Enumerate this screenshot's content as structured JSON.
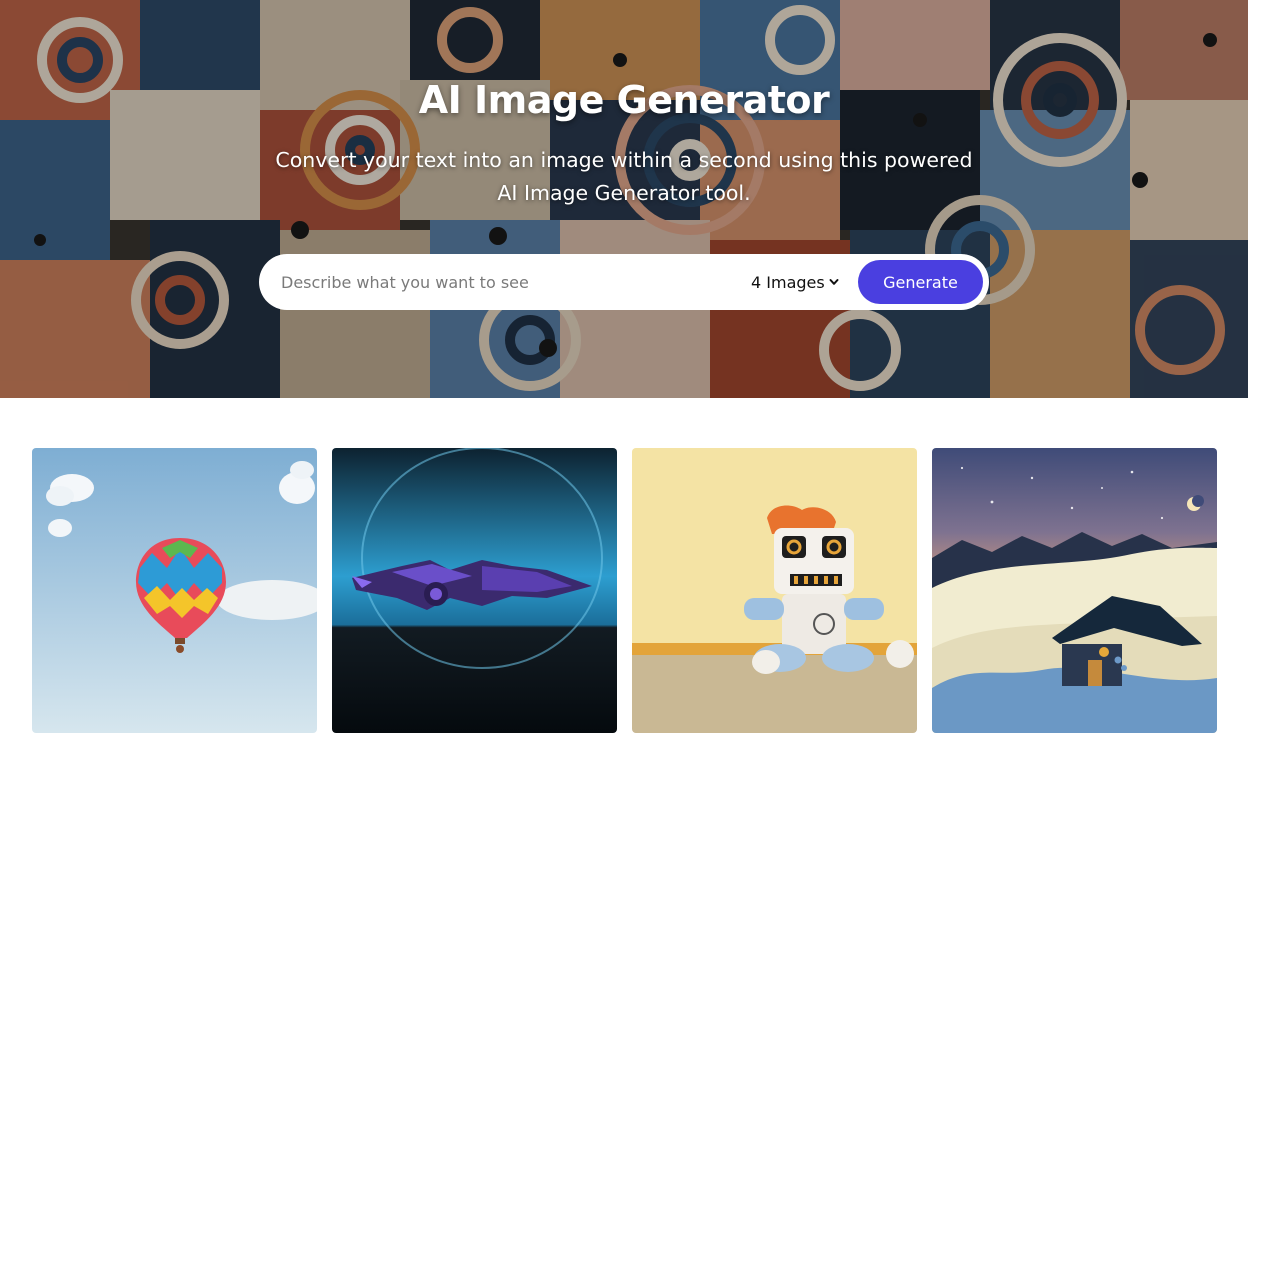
{
  "hero": {
    "title": "AI Image Generator",
    "subtitle_line1": "Convert your text into an image within a second using this powered",
    "subtitle_line2": "AI Image Generator tool."
  },
  "form": {
    "prompt_placeholder": "Describe what you want to see",
    "prompt_value": "",
    "image_count_selected": "4 Images",
    "generate_label": "Generate"
  },
  "colors": {
    "accent": "#4a3fe0",
    "background": "#ffffff"
  },
  "gallery": {
    "images": [
      {
        "subject": "hot-air-balloon"
      },
      {
        "subject": "spaceship"
      },
      {
        "subject": "robot-plush"
      },
      {
        "subject": "snowy-cabin-night"
      }
    ]
  }
}
